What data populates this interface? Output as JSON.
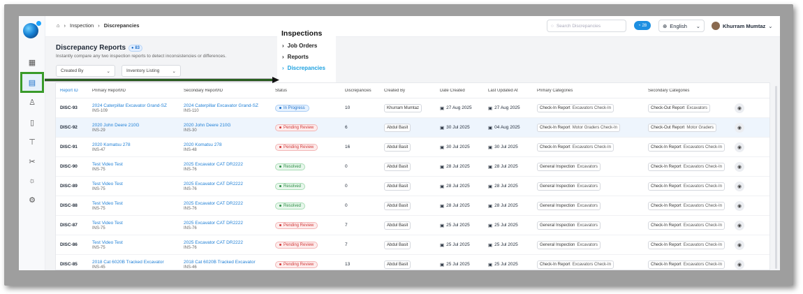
{
  "breadcrumb": {
    "items": [
      "Inspection",
      "Discrepancies"
    ]
  },
  "search": {
    "placeholder": "Search Discrepancies"
  },
  "notifications": {
    "count": "28"
  },
  "language": {
    "value": "English"
  },
  "user": {
    "name": "Khurram Mumtaz"
  },
  "page": {
    "title": "Discrepancy Reports",
    "count": "83",
    "subtitle": "Instantly compare any two inspection reports to detect inconsistencies or differences."
  },
  "filters": [
    {
      "label": "Created By"
    },
    {
      "label": "Inventory Listing"
    }
  ],
  "menu": {
    "title": "Inspections",
    "items": [
      "Job Orders",
      "Reports",
      "Discrepancies"
    ]
  },
  "table": {
    "headers": [
      "Report ID",
      "Primary Report/ID",
      "Secondary Report/ID",
      "Status",
      "Discrepancies",
      "Created By",
      "Date Created",
      "Last Updated At",
      "Primary Categories",
      "Secondary Categories"
    ],
    "rows": [
      {
        "id": "DISC-93",
        "p": "2024 Caterpillar Excavator Grand-SZ",
        "pid": "INS-109",
        "s": "2024 Caterpillar Excavator Grand-SZ",
        "sid": "INS-110",
        "status": "In Progress",
        "disc": "10",
        "by": "Khurram Mumtaz",
        "created": "27 Aug 2025",
        "updated": "27 Aug 2025",
        "pc": "Check-In Report",
        "pc2": "Excavators Check-In",
        "sc": "Check-Out Report",
        "sc2": "Excavators"
      },
      {
        "id": "DISC-92",
        "p": "2020 John Deere 210G",
        "pid": "INS-29",
        "s": "2020 John Deere 210G",
        "sid": "INS-30",
        "status": "Pending Review",
        "disc": "6",
        "by": "Abdul Basit",
        "created": "30 Jul 2025",
        "updated": "04 Aug 2025",
        "pc": "Check-In Report",
        "pc2": "Motor Graders Check-In",
        "sc": "Check-Out Report",
        "sc2": "Motor Graders"
      },
      {
        "id": "DISC-91",
        "p": "2020 Komatsu 278",
        "pid": "INS-47",
        "s": "2020 Komatsu 278",
        "sid": "INS-48",
        "status": "Pending Review",
        "disc": "16",
        "by": "Abdul Basit",
        "created": "30 Jul 2025",
        "updated": "30 Jul 2025",
        "pc": "Check-In Report",
        "pc2": "Excavators Check-In",
        "sc": "Check-In Report",
        "sc2": "Excavators Check-In"
      },
      {
        "id": "DISC-90",
        "p": "Test Video Test",
        "pid": "INS-75",
        "s": "2025 Excavator CAT DR2222",
        "sid": "INS-76",
        "status": "Resolved",
        "disc": "0",
        "by": "Abdul Basit",
        "created": "28 Jul 2025",
        "updated": "28 Jul 2025",
        "pc": "General Inspection",
        "pc2": "Excavators",
        "sc": "Check-In Report",
        "sc2": "Excavators Check-In"
      },
      {
        "id": "DISC-89",
        "p": "Test Video Test",
        "pid": "INS-75",
        "s": "2025 Excavator CAT DR2222",
        "sid": "INS-76",
        "status": "Resolved",
        "disc": "0",
        "by": "Abdul Basit",
        "created": "28 Jul 2025",
        "updated": "28 Jul 2025",
        "pc": "General Inspection",
        "pc2": "Excavators",
        "sc": "Check-In Report",
        "sc2": "Excavators Check-In"
      },
      {
        "id": "DISC-88",
        "p": "Test Video Test",
        "pid": "INS-75",
        "s": "2025 Excavator CAT DR2222",
        "sid": "INS-76",
        "status": "Resolved",
        "disc": "0",
        "by": "Abdul Basit",
        "created": "28 Jul 2025",
        "updated": "28 Jul 2025",
        "pc": "General Inspection",
        "pc2": "Excavators",
        "sc": "Check-In Report",
        "sc2": "Excavators Check-In"
      },
      {
        "id": "DISC-87",
        "p": "Test Video Test",
        "pid": "INS-75",
        "s": "2025 Excavator CAT DR2222",
        "sid": "INS-76",
        "status": "Pending Review",
        "disc": "7",
        "by": "Abdul Basit",
        "created": "25 Jul 2025",
        "updated": "25 Jul 2025",
        "pc": "General Inspection",
        "pc2": "Excavators",
        "sc": "Check-In Report",
        "sc2": "Excavators Check-In"
      },
      {
        "id": "DISC-86",
        "p": "Test Video Test",
        "pid": "INS-75",
        "s": "2025 Excavator CAT DR2222",
        "sid": "INS-76",
        "status": "Pending Review",
        "disc": "7",
        "by": "Abdul Basit",
        "created": "25 Jul 2025",
        "updated": "25 Jul 2025",
        "pc": "General Inspection",
        "pc2": "Excavators",
        "sc": "Check-In Report",
        "sc2": "Excavators Check-In"
      },
      {
        "id": "DISC-85",
        "p": "2018 Cat 6020B Tracked Excavator",
        "pid": "INS-45",
        "s": "2018 Cat 6020B Tracked Excavator",
        "sid": "INS-46",
        "status": "Pending Review",
        "disc": "13",
        "by": "Abdul Basit",
        "created": "25 Jul 2025",
        "updated": "25 Jul 2025",
        "pc": "Check-In Report",
        "pc2": "Excavators Check-In",
        "sc": "Check-In Report",
        "sc2": "Excavators Check-In"
      }
    ]
  },
  "colors": {
    "accent": "#1e7fd6",
    "highlight_border": "#3a9b2a"
  }
}
